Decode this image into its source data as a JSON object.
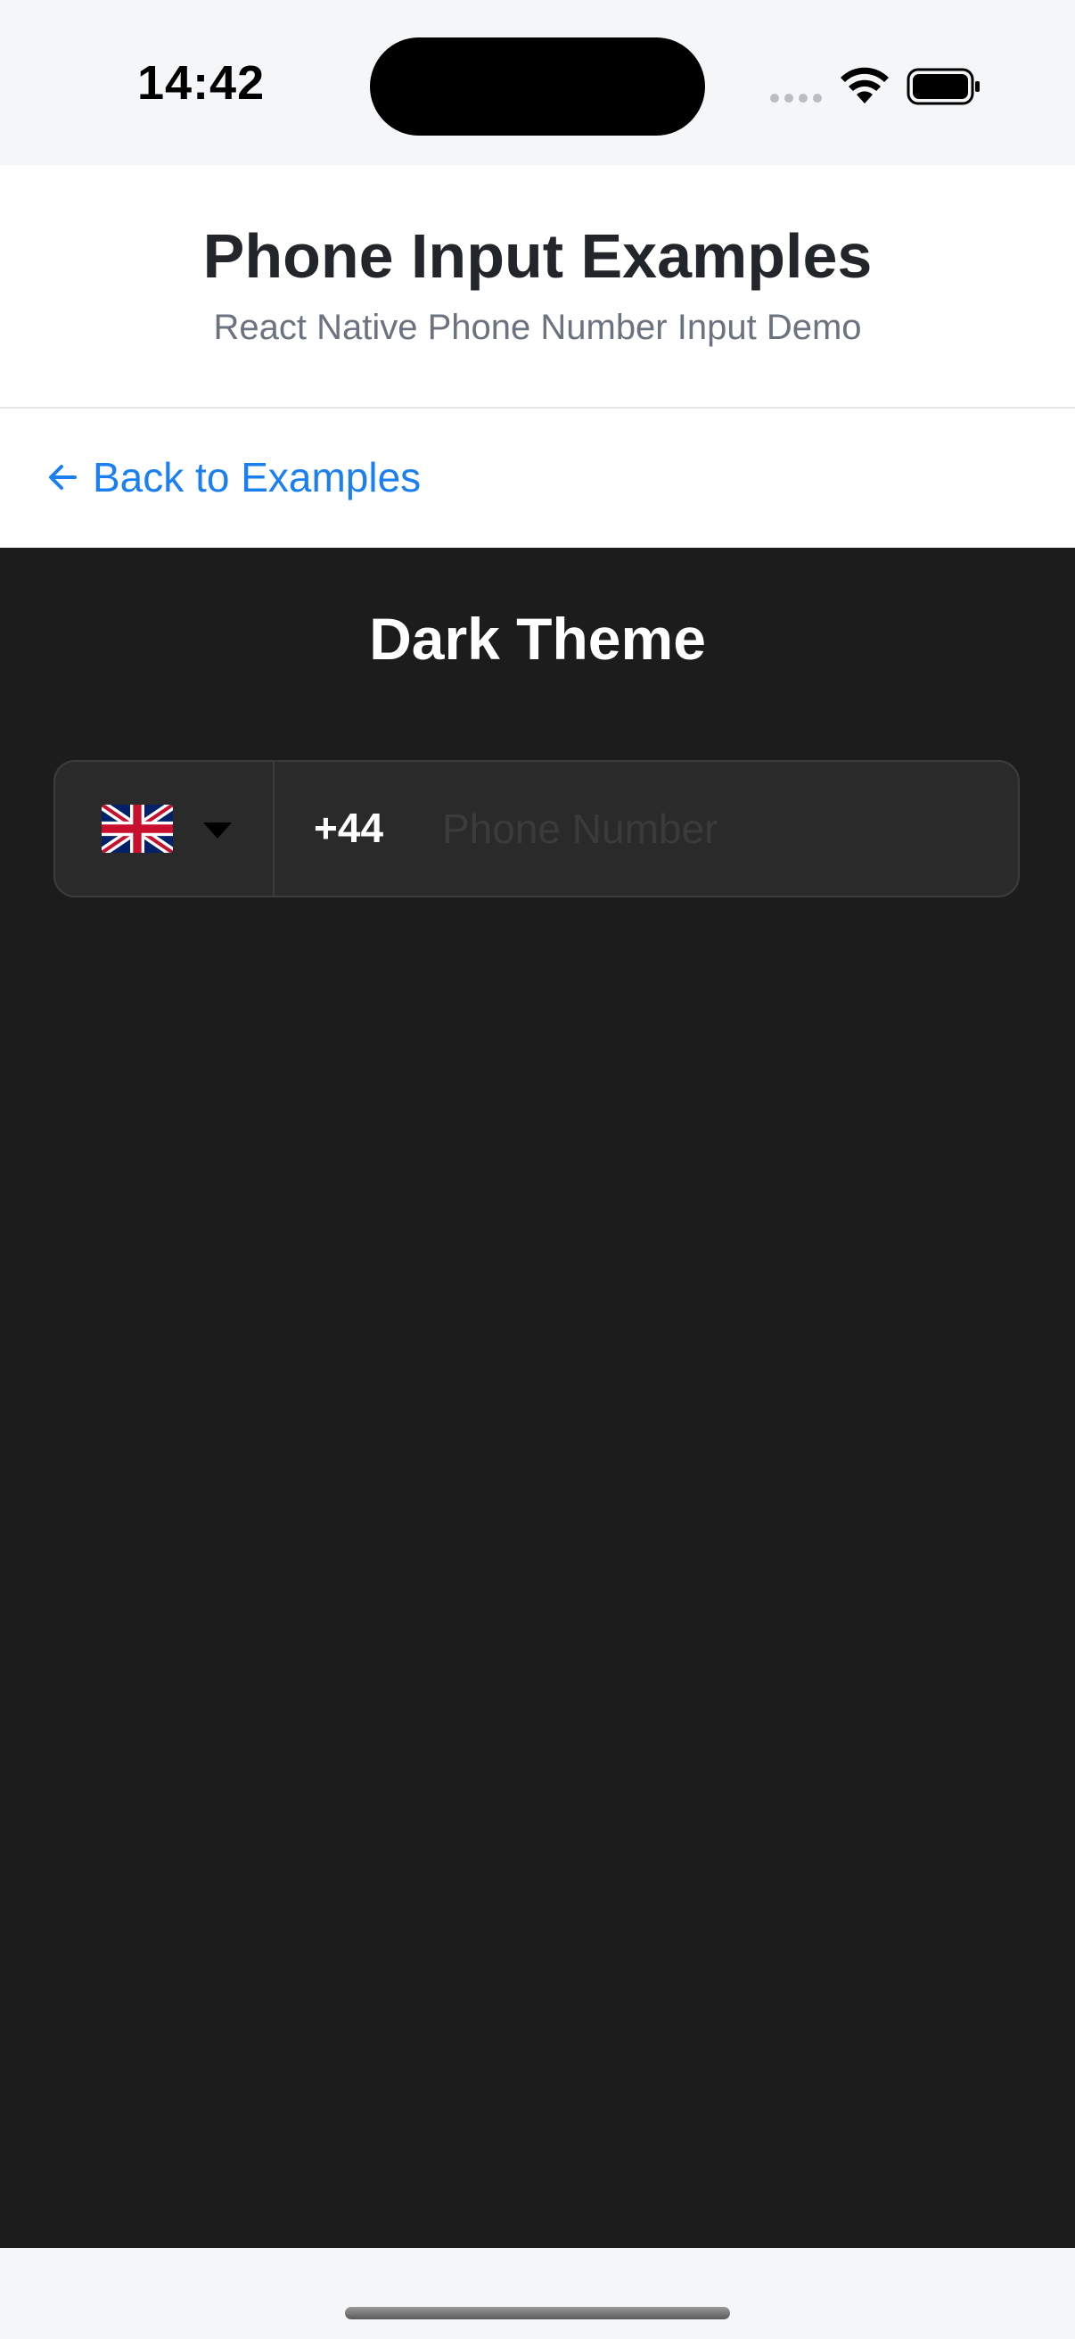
{
  "status_bar": {
    "time": "14:42"
  },
  "header": {
    "title": "Phone Input Examples",
    "subtitle": "React Native Phone Number Input Demo"
  },
  "navigation": {
    "back_label": "Back to Examples"
  },
  "section": {
    "title": "Dark Theme"
  },
  "phone_input": {
    "country_flag": "uk-flag-icon",
    "calling_code": "+44",
    "value": "",
    "placeholder": "Phone Number"
  },
  "colors": {
    "accent": "#1a7ff0",
    "dark_background": "#1c1c1d",
    "input_background": "#2a2a2b"
  }
}
